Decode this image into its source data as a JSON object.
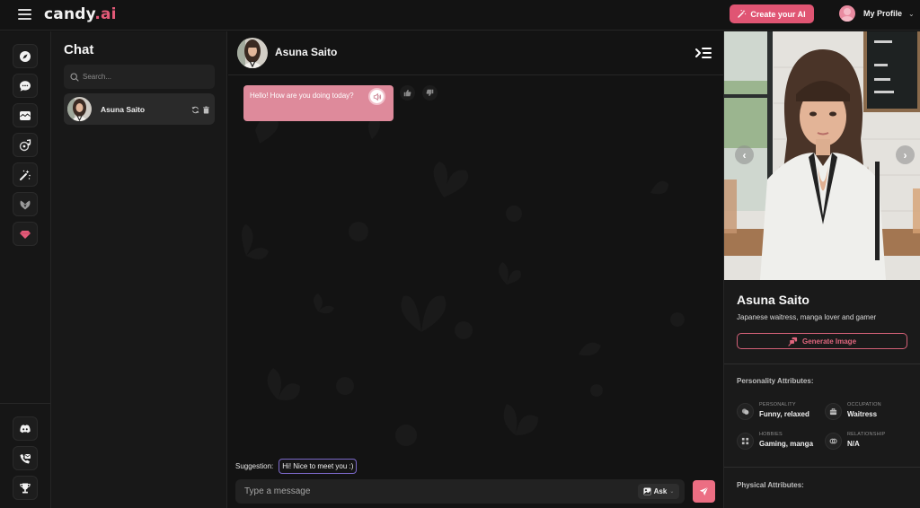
{
  "topbar": {
    "logo_main": "candy",
    "logo_accent": ".ai",
    "create_button": "Create your AI",
    "profile_label": "My Profile",
    "colors": {
      "accent": "#e05573",
      "background": "#131313"
    }
  },
  "rail": {
    "items": [
      {
        "icon": "compass-icon",
        "label": "Explore"
      },
      {
        "icon": "chat-bubble-icon",
        "label": "Chat"
      },
      {
        "icon": "gallery-icon",
        "label": "Gallery"
      },
      {
        "icon": "music-disc-icon",
        "label": "Audio"
      },
      {
        "icon": "magic-wand-icon",
        "label": "Generate"
      },
      {
        "icon": "heart-hands-icon",
        "label": "My AI"
      },
      {
        "icon": "diamond-icon",
        "label": "Premium",
        "color": "#e35a78"
      }
    ],
    "bottom_items": [
      {
        "icon": "discord-icon",
        "label": "Discord"
      },
      {
        "icon": "support-mail-icon",
        "label": "Contact"
      },
      {
        "icon": "trophy-icon",
        "label": "Leaderboard"
      }
    ]
  },
  "chatlist": {
    "title": "Chat",
    "search_placeholder": "Search...",
    "items": [
      {
        "name": "Asuna Saito",
        "active": true
      }
    ]
  },
  "main": {
    "header_name": "Asuna Saito",
    "messages": [
      {
        "sender": "character",
        "text": "Hello! How are you doing today?"
      }
    ],
    "suggestion_label": "Suggestion:",
    "suggestion_text": "Hi! Nice to meet you :)",
    "input_placeholder": "Type a message",
    "ask_label": "Ask",
    "colors": {
      "bubble": "#de8a9b",
      "send": "#ec6e83",
      "suggestion_border": "#7b68c9"
    }
  },
  "profile_panel": {
    "name": "Asuna Saito",
    "description": "Japanese waitress, manga lover and gamer",
    "generate_button": "Generate Image",
    "personality_title": "Personality Attributes:",
    "attributes": [
      {
        "key": "PERSONALITY",
        "value": "Funny, relaxed",
        "icon": "mask-icon"
      },
      {
        "key": "OCCUPATION",
        "value": "Waitress",
        "icon": "briefcase-icon"
      },
      {
        "key": "HOBBIES",
        "value": "Gaming, manga",
        "icon": "hobby-grid-icon"
      },
      {
        "key": "RELATIONSHIP",
        "value": "N/A",
        "icon": "rings-icon"
      }
    ],
    "physical_title": "Physical Attributes:"
  }
}
